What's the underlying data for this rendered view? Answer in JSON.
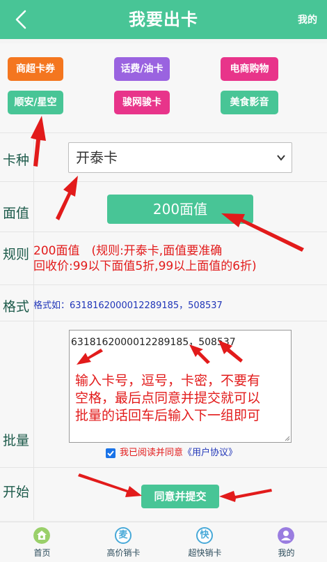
{
  "header": {
    "title": "我要出卡",
    "right_link": "我的"
  },
  "categories": [
    {
      "label": "商超卡券",
      "color": "#f4761f"
    },
    {
      "label": "话费/油卡",
      "color": "#9a63e0"
    },
    {
      "label": "电商购物",
      "color": "#e8348a"
    },
    {
      "label": "顺安/星空",
      "color": "#48c596"
    },
    {
      "label": "骏网骏卡",
      "color": "#e8348a"
    },
    {
      "label": "美食影音",
      "color": "#48c596"
    }
  ],
  "form": {
    "card_type_label": "卡种",
    "card_type_value": "开泰卡",
    "face_label": "面值",
    "face_value": "200面值",
    "rule_label": "规则",
    "rule_line1": "200面值　(规则:开泰卡,面值要准确",
    "rule_line2": "回收价:99以下面值5折,99以上面值的6折)",
    "format_label": "格式",
    "format_text": "格式如：6318162000012289185，508537",
    "batch_label": "批量",
    "batch_value": "6318162000012289185，508537",
    "agree_text": "我已阅读并同意",
    "agree_link": "《用户协议》",
    "start_label": "开始",
    "submit_label": "同意并提交"
  },
  "annotation": {
    "line1": "输入卡号，逗号，卡密，不要有",
    "line2": "空格，最后点同意并提交就可以",
    "line3": "批量的话回车后输入下一组即可"
  },
  "tabbar": [
    {
      "label": "首页",
      "icon": "home-icon",
      "glyph": "",
      "color": "#9ad06a"
    },
    {
      "label": "高价销卡",
      "icon": "mai-icon",
      "glyph": "麦",
      "color": "#48a9d8"
    },
    {
      "label": "超快销卡",
      "icon": "kuai-icon",
      "glyph": "快",
      "color": "#48a9d8"
    },
    {
      "label": "我的",
      "icon": "user-icon",
      "glyph": "",
      "color": "#9a7de0"
    }
  ],
  "colors": {
    "accent": "#48c596",
    "annotation": "#e21b1b"
  }
}
